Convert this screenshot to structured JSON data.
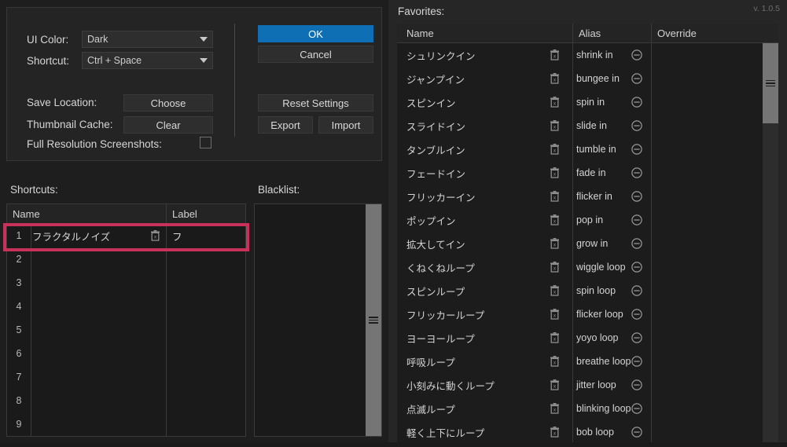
{
  "app": {
    "version": "v. 1.0.5"
  },
  "settings": {
    "ui_color_label": "UI Color:",
    "ui_color_value": "Dark",
    "shortcut_label": "Shortcut:",
    "shortcut_value": "Ctrl + Space",
    "save_location_label": "Save Location:",
    "choose_button": "Choose",
    "thumbnail_cache_label": "Thumbnail Cache:",
    "clear_button": "Clear",
    "full_res_label": "Full Resolution Screenshots:",
    "ok_button": "OK",
    "cancel_button": "Cancel",
    "reset_button": "Reset Settings",
    "export_button": "Export",
    "import_button": "Import",
    "accent_color": "#0f6fb5"
  },
  "shortcuts": {
    "title": "Shortcuts:",
    "columns": [
      "Name",
      "Label"
    ],
    "highlight_color": "#c8325a",
    "rows": [
      {
        "num": "1",
        "name": "フラクタルノイズ",
        "label": "フ",
        "highlighted": true
      },
      {
        "num": "2",
        "name": "",
        "label": ""
      },
      {
        "num": "3",
        "name": "",
        "label": ""
      },
      {
        "num": "4",
        "name": "",
        "label": ""
      },
      {
        "num": "5",
        "name": "",
        "label": ""
      },
      {
        "num": "6",
        "name": "",
        "label": ""
      },
      {
        "num": "7",
        "name": "",
        "label": ""
      },
      {
        "num": "8",
        "name": "",
        "label": ""
      },
      {
        "num": "9",
        "name": "",
        "label": ""
      }
    ]
  },
  "blacklist": {
    "title": "Blacklist:",
    "items": []
  },
  "favorites": {
    "title": "Favorites:",
    "columns": [
      "Name",
      "Alias",
      "Override"
    ],
    "rows": [
      {
        "name": "シュリンクイン",
        "alias": "shrink in",
        "override": ""
      },
      {
        "name": "ジャンプイン",
        "alias": "bungee in",
        "override": ""
      },
      {
        "name": "スピンイン",
        "alias": "spin in",
        "override": ""
      },
      {
        "name": "スライドイン",
        "alias": "slide in",
        "override": ""
      },
      {
        "name": "タンブルイン",
        "alias": "tumble in",
        "override": ""
      },
      {
        "name": "フェードイン",
        "alias": "fade in",
        "override": ""
      },
      {
        "name": "フリッカーイン",
        "alias": "flicker in",
        "override": ""
      },
      {
        "name": "ポップイン",
        "alias": "pop in",
        "override": ""
      },
      {
        "name": "拡大してイン",
        "alias": "grow in",
        "override": ""
      },
      {
        "name": "くねくねループ",
        "alias": "wiggle loop",
        "override": ""
      },
      {
        "name": "スピンループ",
        "alias": "spin loop",
        "override": ""
      },
      {
        "name": "フリッカーループ",
        "alias": "flicker loop",
        "override": ""
      },
      {
        "name": "ヨーヨーループ",
        "alias": "yoyo loop",
        "override": ""
      },
      {
        "name": "呼吸ループ",
        "alias": "breathe loop",
        "override": ""
      },
      {
        "name": "小刻みに動くループ",
        "alias": "jitter loop",
        "override": ""
      },
      {
        "name": "点滅ループ",
        "alias": "blinking loop",
        "override": ""
      },
      {
        "name": "軽く上下にループ",
        "alias": "bob loop",
        "override": ""
      }
    ]
  }
}
